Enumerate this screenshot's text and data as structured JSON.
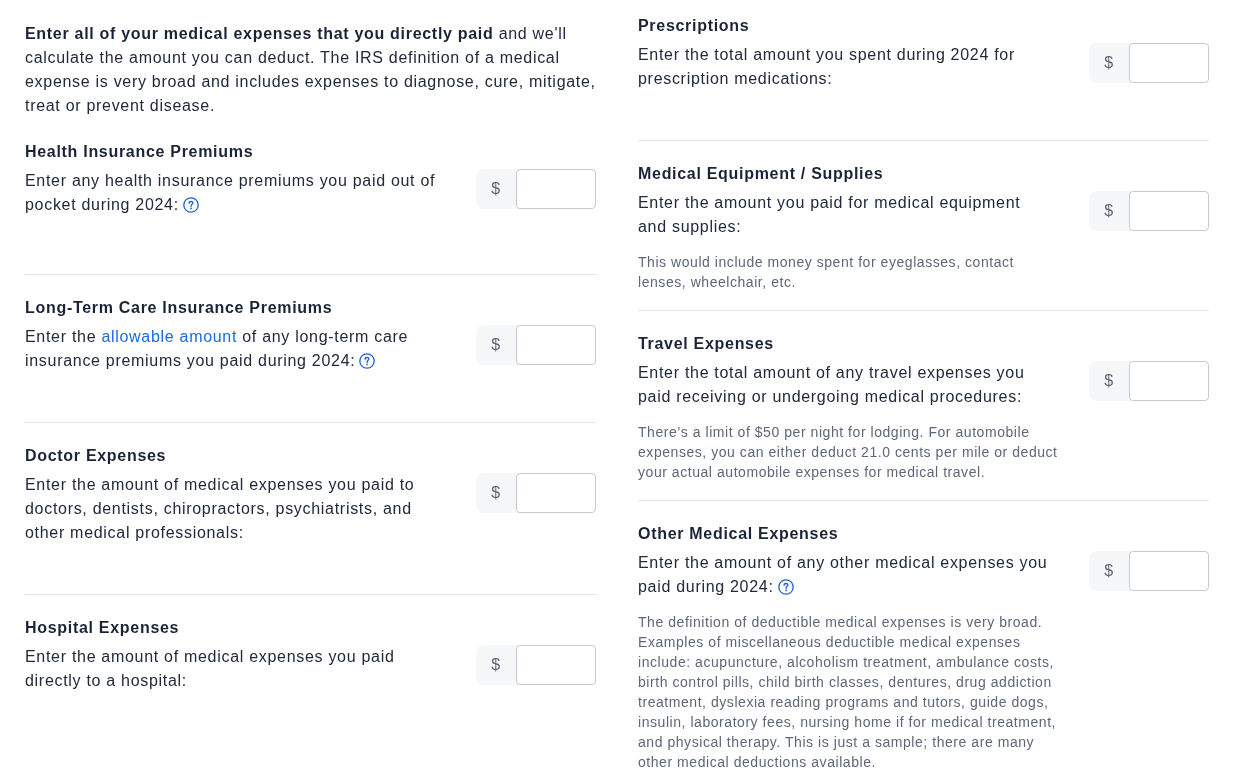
{
  "columns": [
    {
      "intro": "**Enter all of your medical expenses that you directly paid** and we'll calculate the amount you can deduct. The IRS definition of a medical expense is very broad and includes expenses to diagnose, cure, mitigate, treat or prevent disease.",
      "fields": [
        {
          "heading": "Health Insurance Premiums",
          "description": [
            {
              "kind": "text",
              "text": "Enter any health insurance premiums you paid out of pocket during 2024:"
            }
          ],
          "help_icon": true,
          "prefix": "$"
        },
        {
          "heading": "Long-Term Care Insurance Premiums",
          "description": [
            {
              "kind": "text",
              "text": "Enter the "
            },
            {
              "kind": "link",
              "text": "allowable amount"
            },
            {
              "kind": "text",
              "text": " of any long-term care insurance premiums you paid during 2024:"
            }
          ],
          "help_icon": true,
          "prefix": "$"
        },
        {
          "heading": "Doctor Expenses",
          "description": [
            {
              "kind": "text",
              "text": "Enter the amount of medical expenses you paid to doctors, dentists, chiropractors, psychiatrists, and other medical professionals:"
            }
          ],
          "help_icon": false,
          "prefix": "$"
        },
        {
          "heading": "Hospital Expenses",
          "description": [
            {
              "kind": "text",
              "text": "Enter the amount of medical expenses you paid directly to a hospital:"
            }
          ],
          "help_icon": false,
          "prefix": "$"
        }
      ]
    },
    {
      "fields": [
        {
          "heading": "Prescriptions",
          "description": [
            {
              "kind": "text",
              "text": "Enter the total amount you spent during 2024 for prescription medications:"
            }
          ],
          "help_icon": false,
          "prefix": "$"
        },
        {
          "heading": "Medical Equipment / Supplies",
          "description": [
            {
              "kind": "text",
              "text": "Enter the amount you paid for medical equipment and supplies:"
            }
          ],
          "help_icon": false,
          "prefix": "$",
          "note": "This would include money spent for eyeglasses, contact lenses, wheelchair, etc."
        },
        {
          "heading": "Travel Expenses",
          "description": [
            {
              "kind": "text",
              "text": "Enter the total amount of any travel expenses you paid receiving or undergoing medical procedures:"
            }
          ],
          "help_icon": false,
          "prefix": "$",
          "note": "There’s a limit of $50 per night for lodging. For automobile expenses, you can either deduct 21.0 cents per mile or deduct your actual automobile expenses for medical travel."
        },
        {
          "heading": "Other Medical Expenses",
          "description": [
            {
              "kind": "text",
              "text": "Enter the amount of any other medical expenses you paid during 2024:"
            }
          ],
          "help_icon": true,
          "prefix": "$",
          "note": "The definition of deductible medical expenses is very broad. Examples of miscellaneous deductible medical expenses include: acupuncture, alcoholism treatment, ambulance costs, birth control pills, child birth classes, dentures, drug addiction treatment, dyslexia reading programs and tutors, guide dogs, insulin, laboratory fees, nursing home if for medical treatment, and physical therapy. This is just a sample; there are many other medical deductions available."
        }
      ]
    }
  ]
}
